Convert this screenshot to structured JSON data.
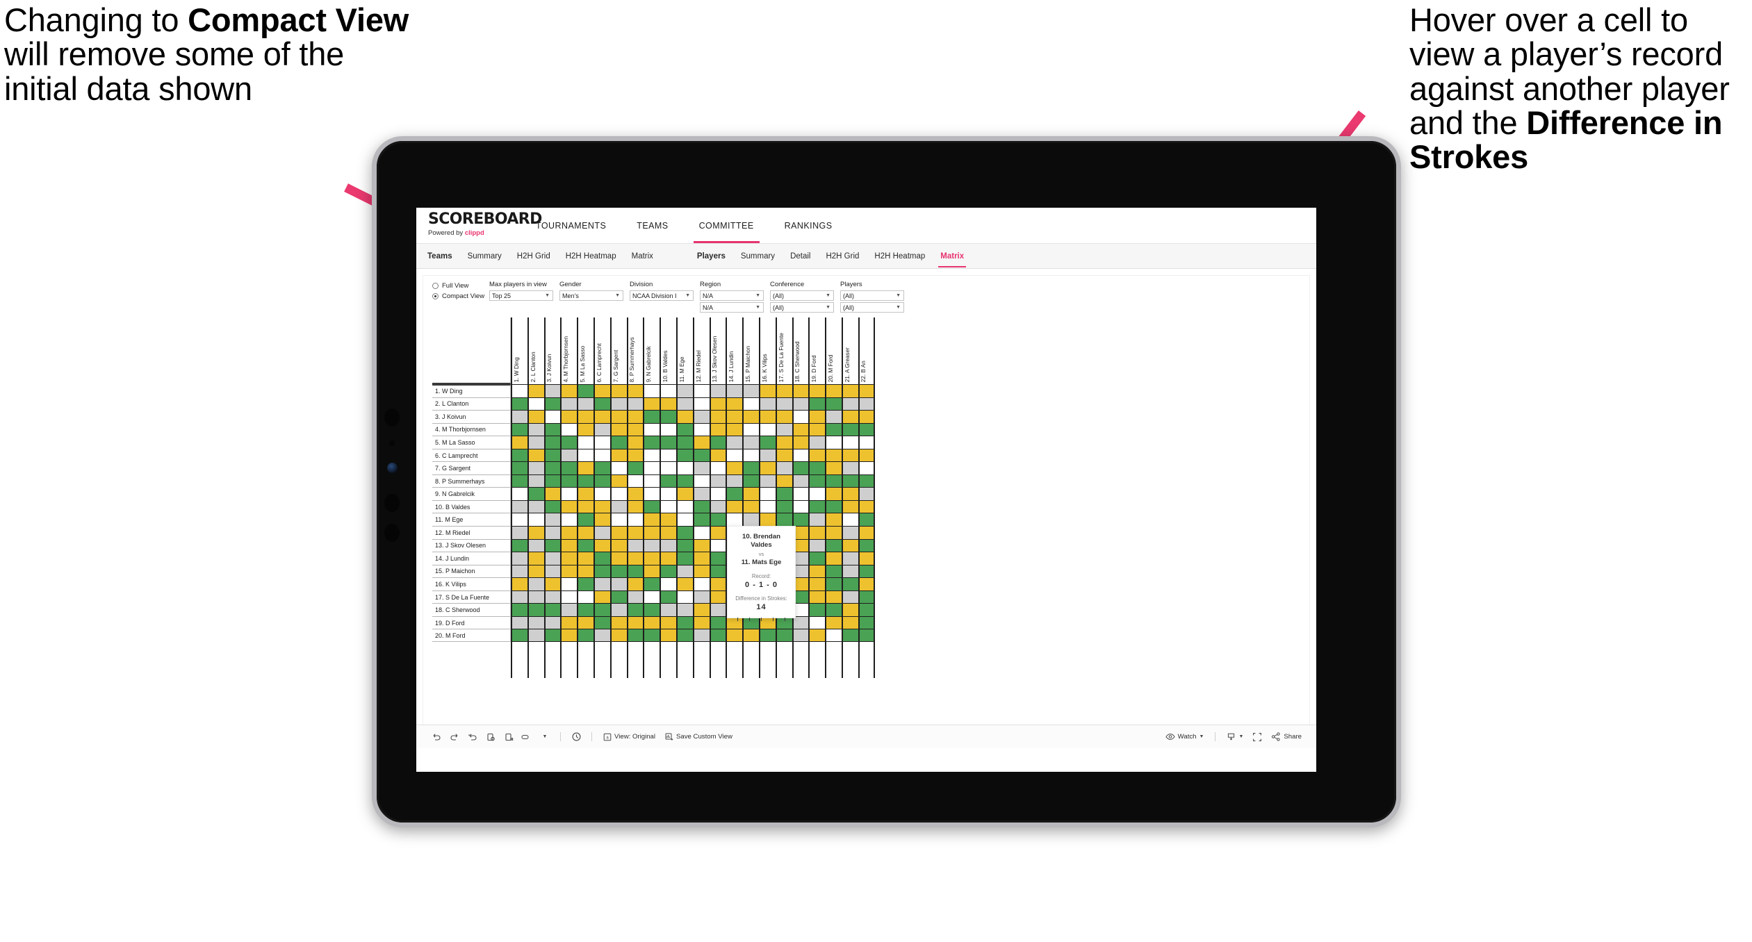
{
  "annotations": {
    "left": {
      "p1": "Changing to ",
      "strong": "Compact View",
      "p2": " will remove some of the initial data shown"
    },
    "right": {
      "p1": "Hover over a cell to view a player’s record against another player and the ",
      "strong": "Difference in Strokes",
      "p2": ""
    },
    "arrow_color": "#ea3a70"
  },
  "app": {
    "brand": {
      "name": "SCOREBOARD",
      "powered_prefix": "Powered by ",
      "powered_brand": "clippd"
    },
    "topnav": [
      {
        "label": "TOURNAMENTS",
        "active": false
      },
      {
        "label": "TEAMS",
        "active": false
      },
      {
        "label": "COMMITTEE",
        "active": true
      },
      {
        "label": "RANKINGS",
        "active": false
      }
    ],
    "subnav": {
      "teams_group": {
        "label": "Teams",
        "items": [
          "Summary",
          "H2H Grid",
          "H2H Heatmap",
          "Matrix"
        ]
      },
      "players_group": {
        "label": "Players",
        "items": [
          "Summary",
          "Detail",
          "H2H Grid",
          "H2H Heatmap",
          "Matrix"
        ],
        "active": "Matrix"
      }
    },
    "accent": "#e8336e"
  },
  "filters": {
    "view_options": [
      {
        "label": "Full View",
        "selected": false
      },
      {
        "label": "Compact View",
        "selected": true
      }
    ],
    "selects": [
      {
        "label": "Max players in view",
        "value": "Top 25"
      },
      {
        "label": "Gender",
        "value": "Men’s"
      },
      {
        "label": "Division",
        "value": "NCAA Division I"
      },
      {
        "label": "Region",
        "value": "N/A",
        "value2": "N/A"
      },
      {
        "label": "Conference",
        "value": "(All)",
        "value2": "(All)"
      },
      {
        "label": "Players",
        "value": "(All)",
        "value2": "(All)"
      }
    ]
  },
  "matrix": {
    "row_labels": [
      "1. W Ding",
      "2. L Clanton",
      "3. J Koivun",
      "4. M Thorbjornsen",
      "5. M La Sasso",
      "6. C Lamprecht",
      "7. G Sargent",
      "8. P Summerhays",
      "9. N Gabrelcik",
      "10. B Valdes",
      "11. M Ege",
      "12. M Riedel",
      "13. J Skov Olesen",
      "14. J Lundin",
      "15. P Maichon",
      "16. K Vilips",
      "17. S De La Fuente",
      "18. C Sherwood",
      "19. D Ford",
      "20. M Ford"
    ],
    "col_labels": [
      "1. W Ding",
      "2. L Clanton",
      "3. J Koivun",
      "4. M Thorbjornsen",
      "5. M La Sasso",
      "6. C Lamprecht",
      "7. G Sargent",
      "8. P Summerhays",
      "9. N Gabrelcik",
      "10. B Valdes",
      "11. M Ege",
      "12. M Riedel",
      "13. J Skov Olesen",
      "14. J Lundin",
      "15. P Maichon",
      "16. K Vilips",
      "17. S De La Fuente",
      "18. C Sherwood",
      "19. D Ford",
      "20. M Ford",
      "21. A Greaser",
      "22. B An"
    ],
    "legend_colors": {
      "win": "#4aa254",
      "tie": "#eec22e",
      "loss": "#cfcfcf",
      "none": "#ffffff"
    },
    "cells": [
      [
        "w",
        "y",
        "a",
        "y",
        "g",
        "y",
        "y",
        "y",
        "w",
        "w",
        "a",
        "w",
        "a",
        "a",
        "a",
        "y",
        "y",
        "y",
        "y",
        "y",
        "y",
        "y"
      ],
      [
        "g",
        "w",
        "g",
        "a",
        "a",
        "g",
        "a",
        "a",
        "y",
        "y",
        "a",
        "w",
        "y",
        "y",
        "w",
        "a",
        "a",
        "a",
        "g",
        "g",
        "a",
        "a"
      ],
      [
        "a",
        "y",
        "w",
        "y",
        "y",
        "y",
        "y",
        "y",
        "g",
        "g",
        "y",
        "a",
        "y",
        "y",
        "y",
        "y",
        "y",
        "w",
        "y",
        "a",
        "y",
        "y"
      ],
      [
        "g",
        "a",
        "g",
        "w",
        "y",
        "a",
        "y",
        "y",
        "w",
        "w",
        "g",
        "w",
        "y",
        "y",
        "w",
        "w",
        "a",
        "y",
        "y",
        "g",
        "g",
        "g"
      ],
      [
        "y",
        "a",
        "g",
        "g",
        "w",
        "w",
        "g",
        "y",
        "g",
        "g",
        "g",
        "y",
        "g",
        "a",
        "a",
        "g",
        "y",
        "y",
        "a",
        "w",
        "w",
        "w"
      ],
      [
        "g",
        "y",
        "g",
        "a",
        "w",
        "w",
        "y",
        "y",
        "w",
        "w",
        "g",
        "g",
        "y",
        "w",
        "w",
        "a",
        "y",
        "w",
        "y",
        "y",
        "y",
        "y"
      ],
      [
        "g",
        "a",
        "g",
        "g",
        "y",
        "g",
        "w",
        "g",
        "w",
        "w",
        "w",
        "a",
        "w",
        "y",
        "g",
        "y",
        "a",
        "g",
        "g",
        "y",
        "a",
        "w"
      ],
      [
        "g",
        "a",
        "g",
        "g",
        "g",
        "g",
        "y",
        "w",
        "w",
        "g",
        "g",
        "w",
        "a",
        "a",
        "g",
        "a",
        "y",
        "a",
        "g",
        "g",
        "g",
        "g"
      ],
      [
        "w",
        "g",
        "y",
        "w",
        "y",
        "w",
        "w",
        "y",
        "w",
        "w",
        "y",
        "a",
        "w",
        "g",
        "y",
        "w",
        "g",
        "w",
        "w",
        "y",
        "y",
        "a"
      ],
      [
        "a",
        "a",
        "g",
        "y",
        "y",
        "y",
        "a",
        "y",
        "g",
        "w",
        "w",
        "g",
        "a",
        "y",
        "y",
        "w",
        "g",
        "w",
        "g",
        "g",
        "y",
        "y"
      ],
      [
        "w",
        "w",
        "a",
        "w",
        "g",
        "y",
        "w",
        "w",
        "y",
        "y",
        "w",
        "g",
        "g",
        "w",
        "a",
        "y",
        "g",
        "g",
        "a",
        "y",
        "w",
        "g"
      ],
      [
        "a",
        "y",
        "a",
        "y",
        "y",
        "a",
        "y",
        "y",
        "y",
        "y",
        "g",
        "w",
        "y",
        "g",
        "g",
        "a",
        "y",
        "y",
        "y",
        "y",
        "a",
        "y"
      ],
      [
        "g",
        "a",
        "g",
        "y",
        "g",
        "y",
        "y",
        "a",
        "a",
        "a",
        "g",
        "y",
        "w",
        "a",
        "a",
        "g",
        "g",
        "y",
        "a",
        "g",
        "y",
        "g"
      ],
      [
        "a",
        "y",
        "a",
        "y",
        "y",
        "g",
        "y",
        "y",
        "y",
        "y",
        "g",
        "y",
        "g",
        "w",
        "w",
        "y",
        "g",
        "a",
        "g",
        "y",
        "a",
        "y"
      ],
      [
        "a",
        "y",
        "a",
        "y",
        "y",
        "g",
        "g",
        "g",
        "y",
        "g",
        "a",
        "y",
        "g",
        "g",
        "w",
        "g",
        "g",
        "a",
        "y",
        "g",
        "a",
        "g"
      ],
      [
        "y",
        "a",
        "y",
        "w",
        "g",
        "a",
        "a",
        "y",
        "g",
        "w",
        "y",
        "w",
        "y",
        "g",
        "a",
        "w",
        "g",
        "y",
        "y",
        "g",
        "g",
        "y"
      ],
      [
        "a",
        "a",
        "a",
        "w",
        "w",
        "y",
        "g",
        "a",
        "w",
        "g",
        "w",
        "a",
        "y",
        "a",
        "a",
        "a",
        "w",
        "g",
        "y",
        "y",
        "a",
        "g"
      ],
      [
        "g",
        "g",
        "g",
        "a",
        "g",
        "g",
        "a",
        "g",
        "g",
        "a",
        "a",
        "y",
        "a",
        "y",
        "g",
        "y",
        "a",
        "w",
        "g",
        "g",
        "y",
        "g"
      ],
      [
        "a",
        "a",
        "a",
        "y",
        "y",
        "g",
        "y",
        "y",
        "y",
        "y",
        "g",
        "y",
        "g",
        "y",
        "g",
        "y",
        "g",
        "a",
        "w",
        "y",
        "y",
        "g"
      ],
      [
        "g",
        "a",
        "g",
        "y",
        "g",
        "a",
        "y",
        "g",
        "g",
        "y",
        "g",
        "a",
        "g",
        "y",
        "y",
        "g",
        "g",
        "a",
        "y",
        "w",
        "g",
        "g"
      ]
    ]
  },
  "tooltip": {
    "player_a": "10. Brendan Valdes",
    "vs": "vs",
    "player_b": "11. Mats Ege",
    "record_label": "Record:",
    "record_value": "0 - 1 - 0",
    "diff_label": "Difference in Strokes:",
    "diff_value": "14"
  },
  "toolbar": {
    "icons": [
      "undo-icon",
      "redo-icon",
      "revert-icon",
      "refresh-icon",
      "pause-icon",
      "zoom-icon"
    ],
    "view_label": "View: Original",
    "save_label": "Save Custom View",
    "watch_label": "Watch",
    "share_label": "Share"
  }
}
